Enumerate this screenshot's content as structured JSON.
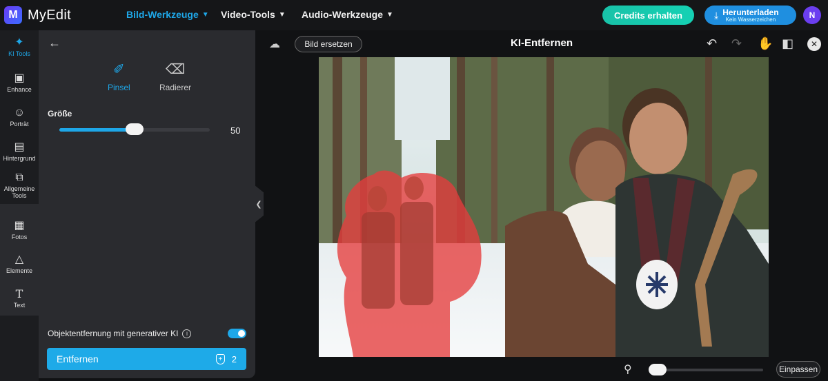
{
  "app": {
    "logo_letter": "M",
    "name": "MyEdit"
  },
  "nav": [
    {
      "label": "Bild-Werkzeuge",
      "active": true
    },
    {
      "label": "Video-Tools",
      "active": false
    },
    {
      "label": "Audio-Werkzeuge",
      "active": false
    }
  ],
  "header": {
    "credits_label": "Credits erhalten",
    "download_label": "Herunterladen",
    "download_sublabel": "Kein Wasserzeichen",
    "avatar_initial": "N"
  },
  "rail": {
    "items": [
      {
        "label": "KI Tools",
        "icon": "magic-wand-icon",
        "active": true
      },
      {
        "label": "Enhance",
        "icon": "enhance-icon"
      },
      {
        "label": "Porträt",
        "icon": "portrait-icon"
      },
      {
        "label": "Hintergrund",
        "icon": "background-icon"
      },
      {
        "label": "Allgemeine Tools",
        "icon": "general-tools-icon"
      },
      {
        "label": "Fotos",
        "icon": "photos-icon"
      },
      {
        "label": "Elemente",
        "icon": "elements-icon"
      },
      {
        "label": "Text",
        "icon": "text-icon"
      }
    ]
  },
  "panel": {
    "modes": [
      {
        "label": "Pinsel",
        "icon": "brush-icon",
        "active": true
      },
      {
        "label": "Radierer",
        "icon": "eraser-icon",
        "active": false
      }
    ],
    "size_label": "Größe",
    "size_value": "50",
    "size_fraction": 0.5,
    "generative_label": "Objektentfernung mit generativer KI",
    "generative_on": true,
    "remove_label": "Entfernen",
    "remove_cost": "2"
  },
  "editor": {
    "replace_label": "Bild ersetzen",
    "title": "KI-Entfernen",
    "fit_label": "Einpassen",
    "zoom_fraction": 0.0
  },
  "colors": {
    "accent": "#1ea7e8",
    "credits": "#18c2a8",
    "mask": "#e63c3c"
  }
}
